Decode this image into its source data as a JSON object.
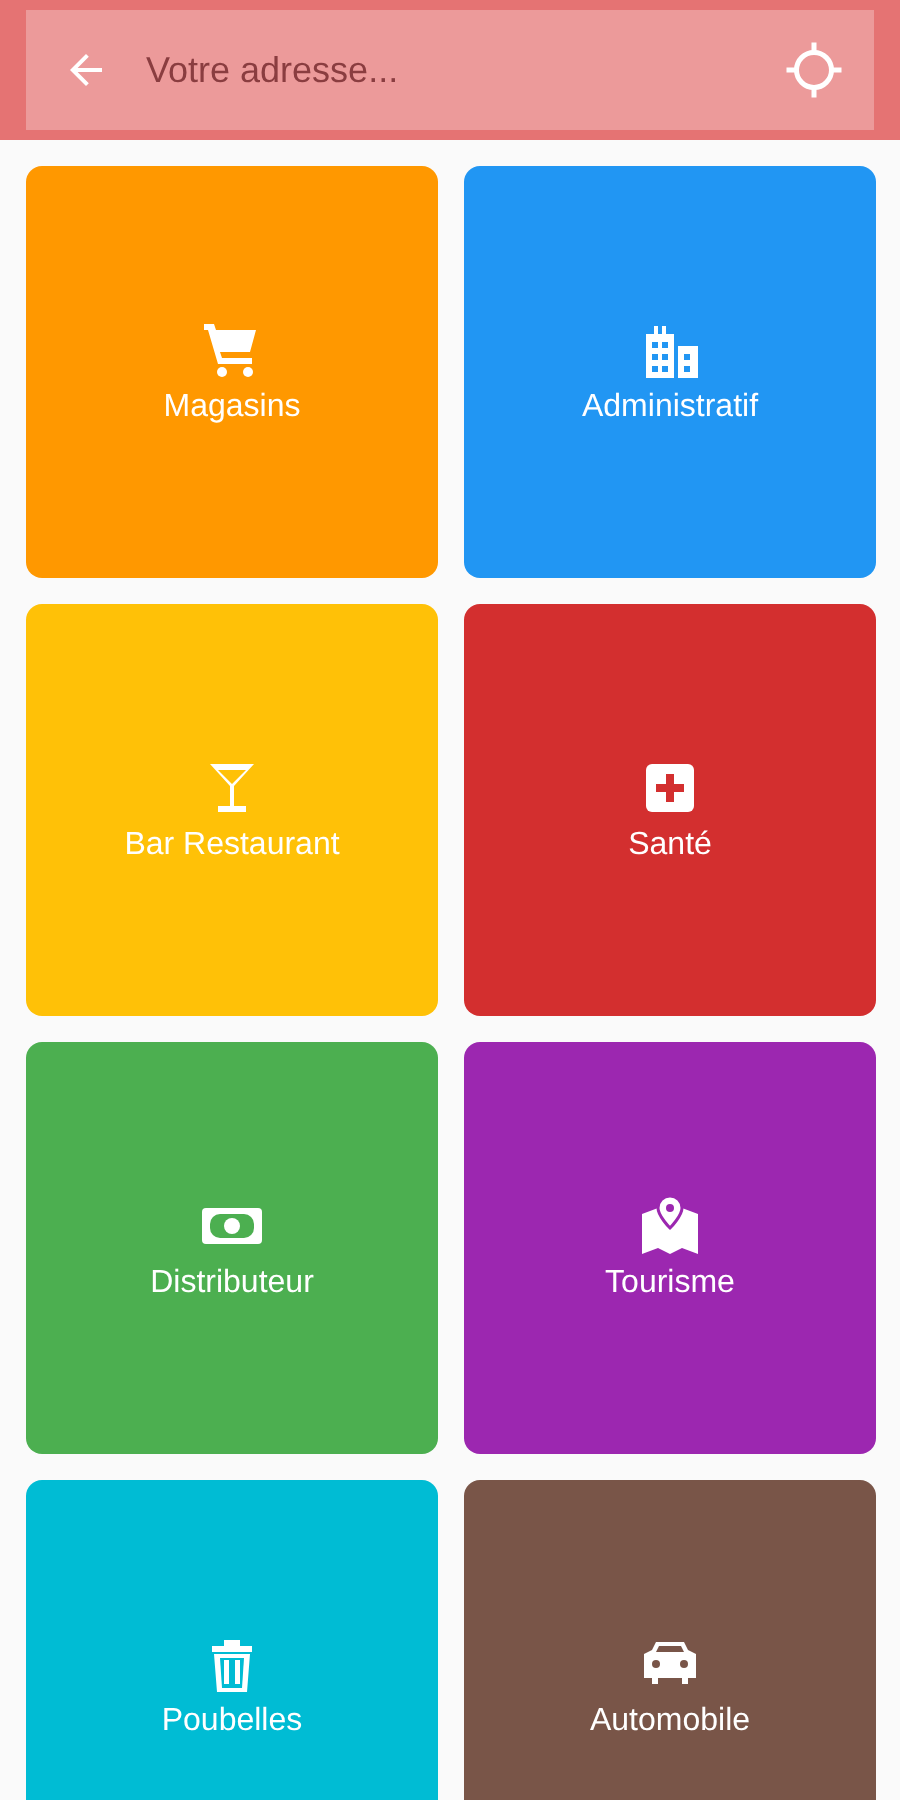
{
  "search": {
    "placeholder": "Votre adresse..."
  },
  "categories": [
    {
      "label": "Magasins",
      "color": "#ff9800"
    },
    {
      "label": "Administratif",
      "color": "#2196f3"
    },
    {
      "label": "Bar Restaurant",
      "color": "#ffc107"
    },
    {
      "label": "Santé",
      "color": "#d32f2f"
    },
    {
      "label": "Distributeur",
      "color": "#4caf50"
    },
    {
      "label": "Tourisme",
      "color": "#9c27b0"
    },
    {
      "label": "Poubelles",
      "color": "#00bcd4"
    },
    {
      "label": "Automobile",
      "color": "#795548"
    }
  ]
}
